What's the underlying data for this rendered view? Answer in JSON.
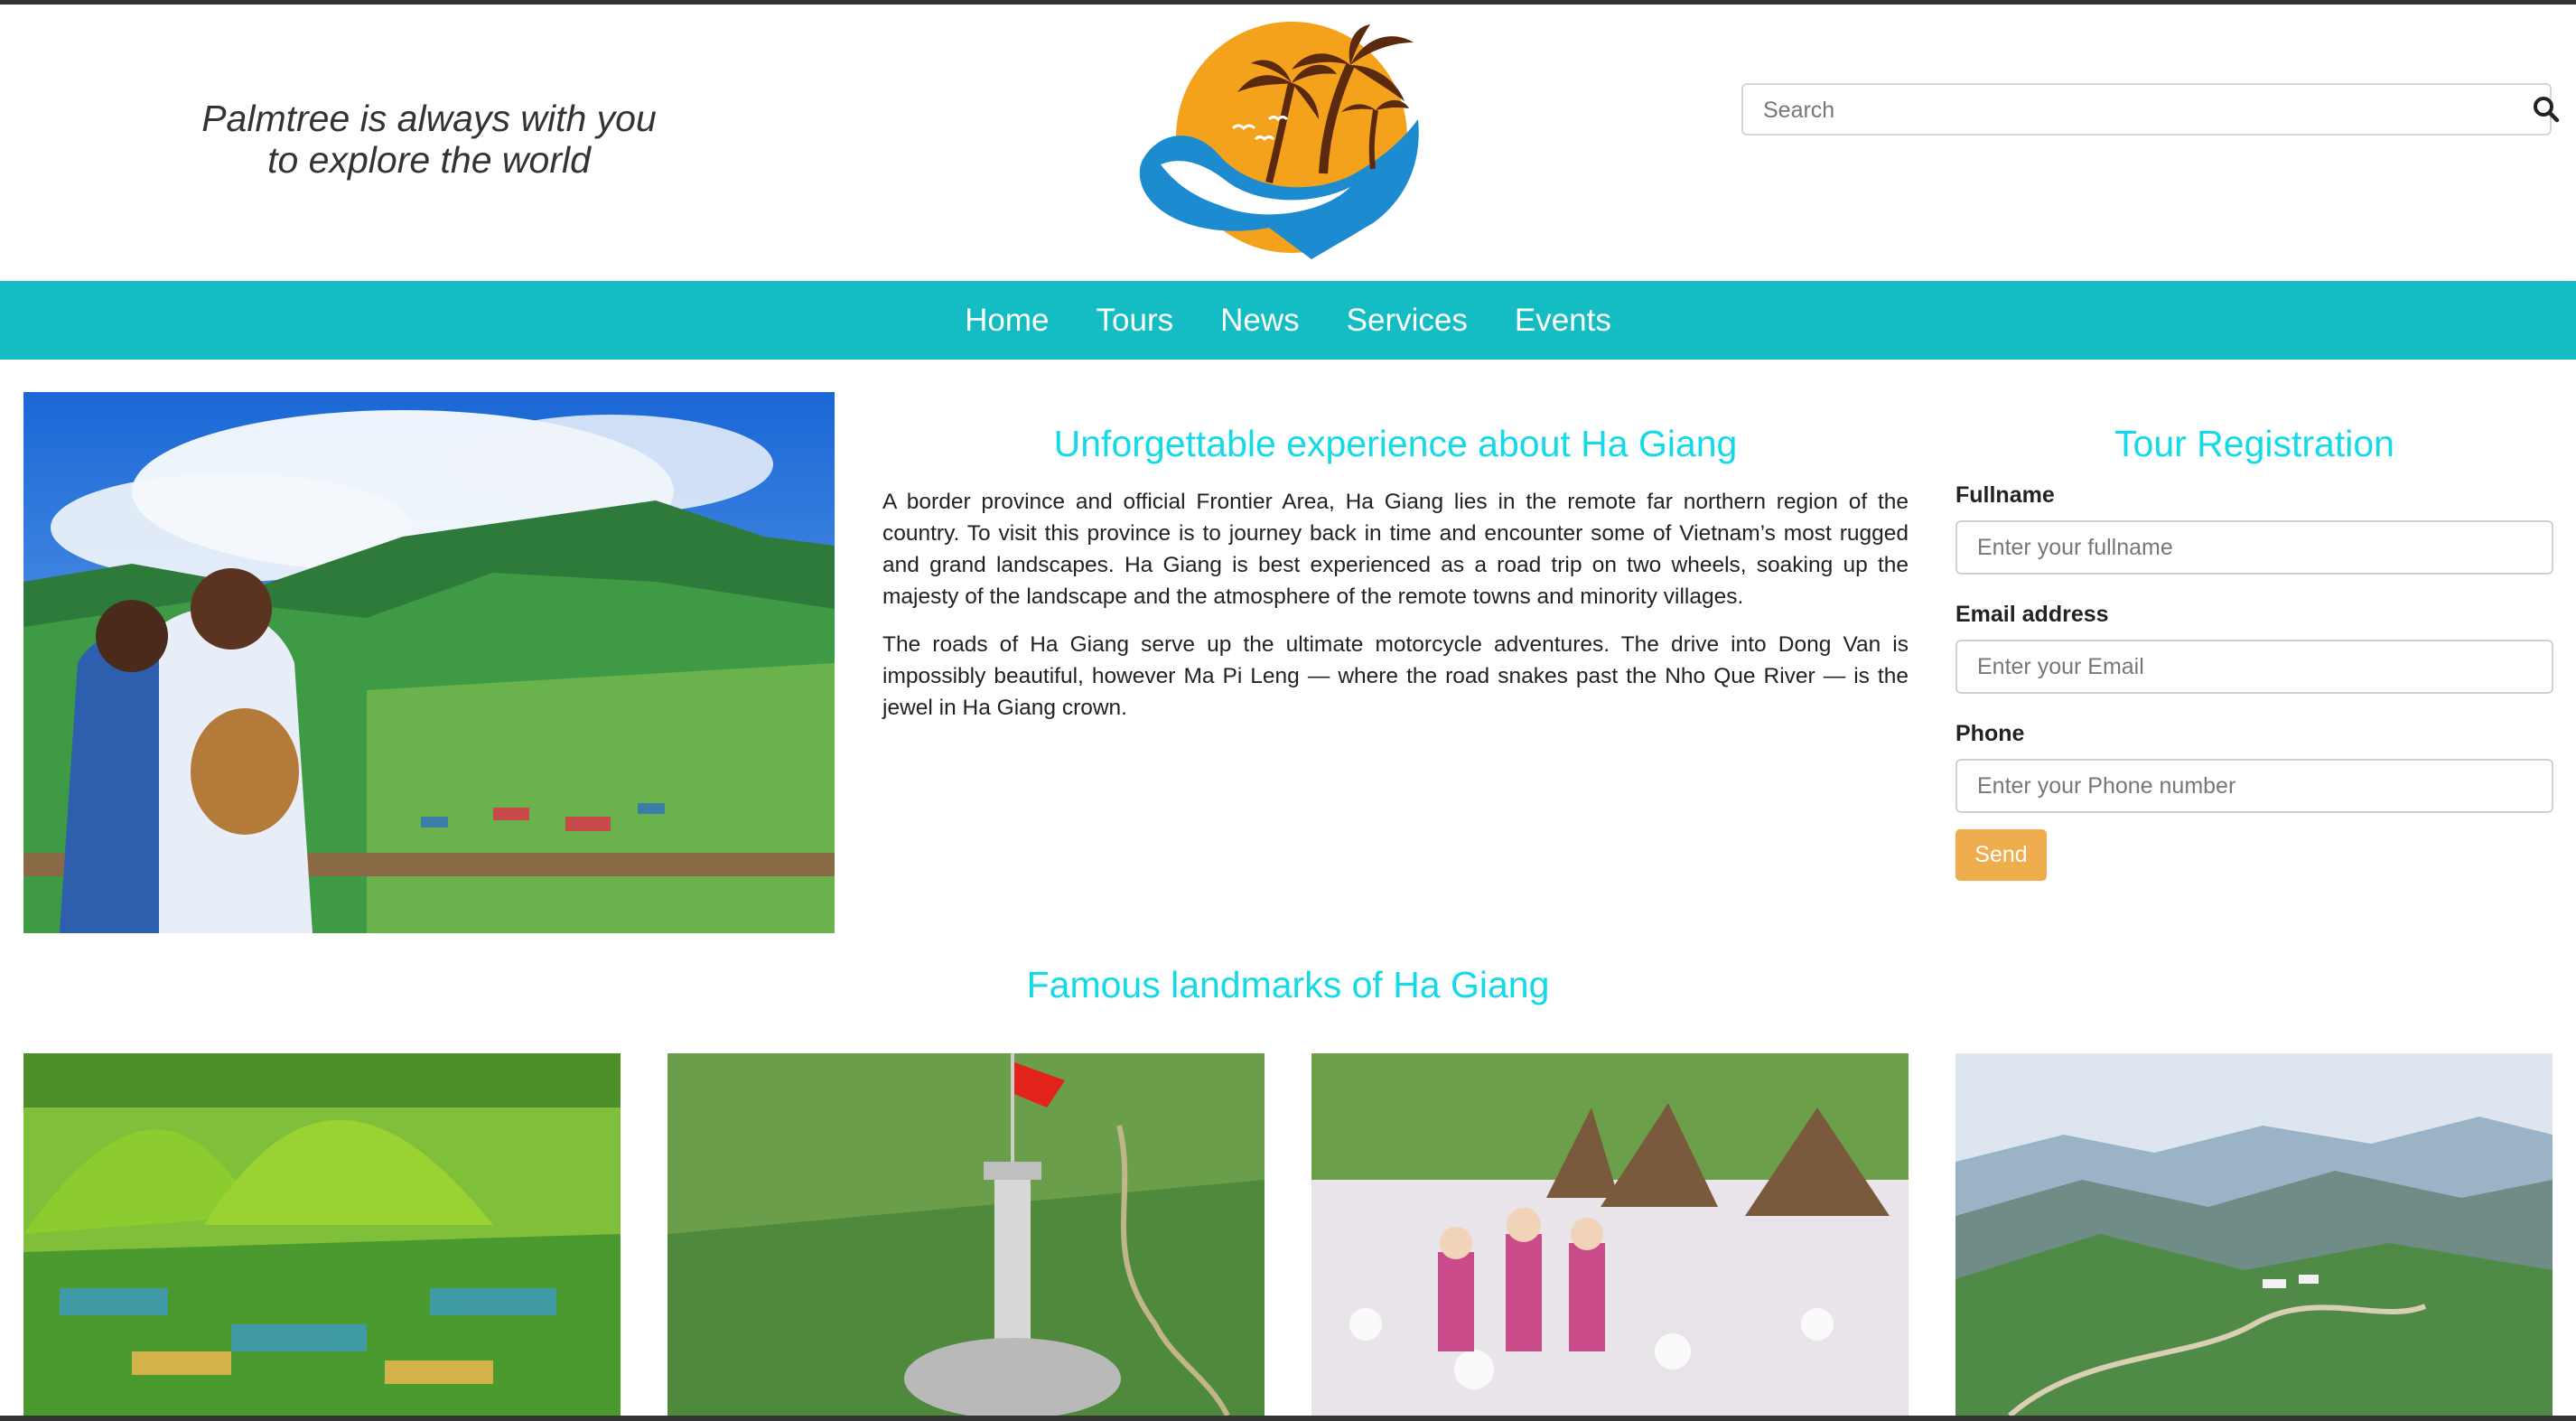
{
  "header": {
    "tagline_line1": "Palmtree is always with you",
    "tagline_line2": "to explore the world",
    "search_placeholder": "Search",
    "search_icon": "search-icon",
    "logo_icon": "palm-tree-sunset-logo-icon"
  },
  "nav": {
    "items": [
      "Home",
      "Tours",
      "News",
      "Services",
      "Events"
    ]
  },
  "article": {
    "title": "Unforgettable experience about Ha Giang",
    "paragraph1": "A border province and official Frontier Area, Ha Giang lies in the remote far northern region of the country. To visit this province is to journey back in time and encounter some of Vietnam’s most rugged and grand landscapes. Ha Giang is best experienced as a road trip on two wheels, soaking up the majesty of the landscape and the atmosphere of the remote towns and minority villages.",
    "paragraph2": "The roads of Ha Giang serve up the ultimate motorcycle adventures. The drive into Dong Van is impossibly beautiful, however Ma Pi Leng — where the road snakes past the Nho Que River — is the jewel in Ha Giang crown."
  },
  "registration": {
    "title": "Tour Registration",
    "fullname_label": "Fullname",
    "fullname_placeholder": "Enter your fullname",
    "email_label": "Email address",
    "email_placeholder": "Enter your Email",
    "phone_label": "Phone",
    "phone_placeholder": "Enter your Phone number",
    "send_label": "Send"
  },
  "landmarks": {
    "title": "Famous landmarks of Ha Giang"
  },
  "colors": {
    "nav_bg": "#13bdc3",
    "heading": "#14d9e6",
    "send_button": "#f0ad4e"
  }
}
